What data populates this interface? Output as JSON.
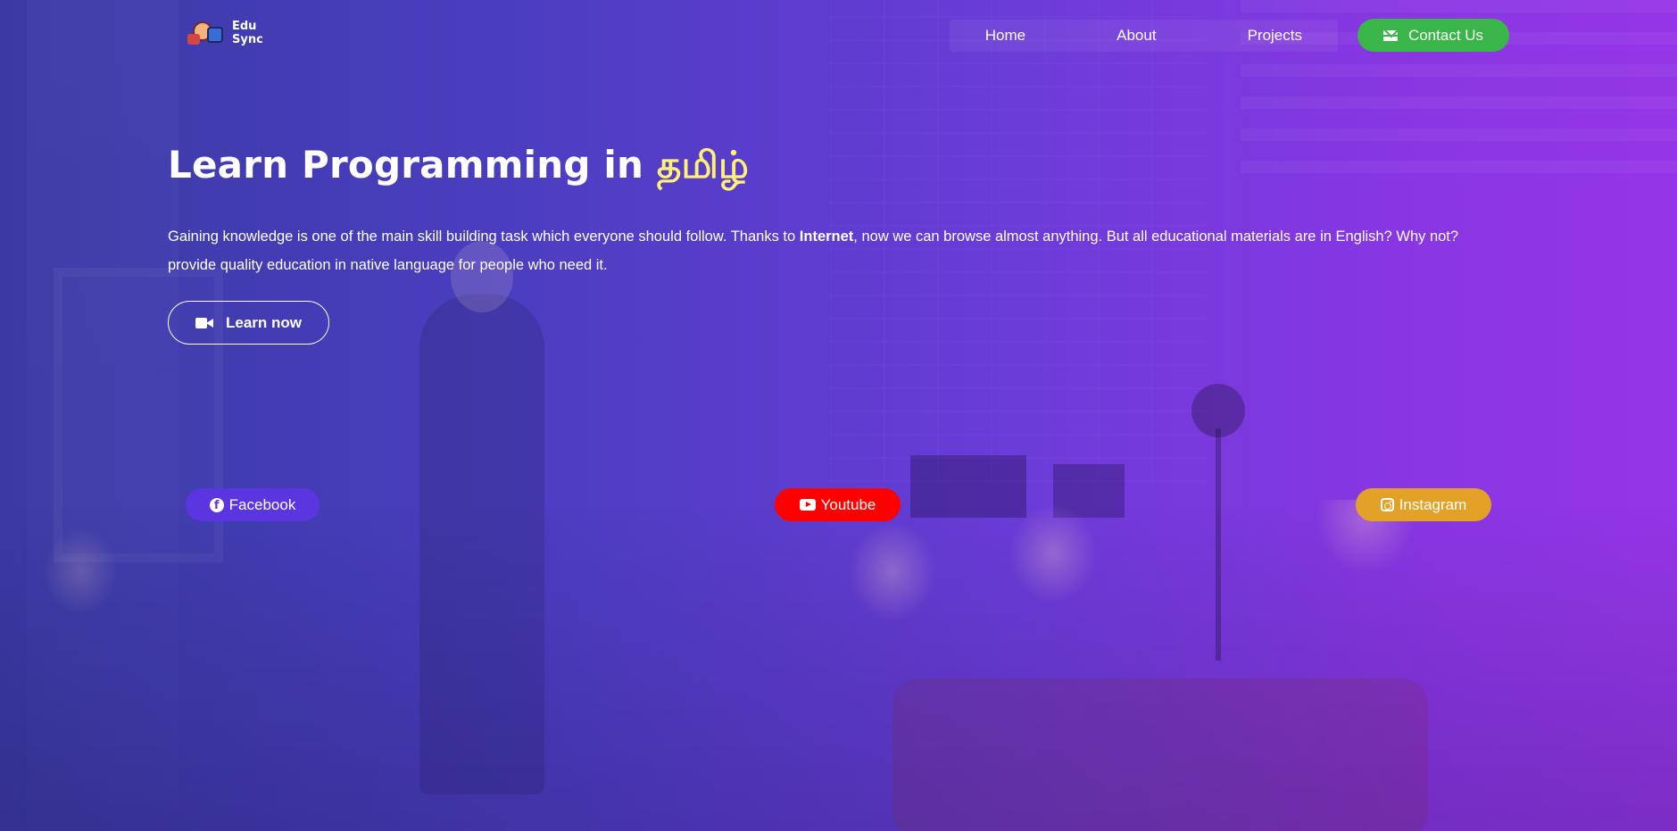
{
  "brand": {
    "name_line1": "Edu",
    "name_line2": "Sync"
  },
  "nav": {
    "items": [
      {
        "label": "Home"
      },
      {
        "label": "About"
      },
      {
        "label": "Projects"
      }
    ],
    "contact": {
      "label": "Contact Us",
      "icon": "envelope-icon",
      "color": "#3ab54a"
    }
  },
  "hero": {
    "title_prefix": "Learn Programming in ",
    "title_accent": "தமிழ்",
    "accent_color": "#fff176",
    "desc_part1": "Gaining knowledge is one of the main skill building task which everyone should follow. Thanks to ",
    "desc_bold": "Internet",
    "desc_part2": ", now we can browse almost anything. But all educational materials are in English? Why not? provide quality education in native language for people who need it.",
    "cta": {
      "label": "Learn now",
      "icon": "video-camera-icon"
    }
  },
  "social": [
    {
      "label": "Facebook",
      "icon": "facebook-icon",
      "color": "#5b35e0"
    },
    {
      "label": "Youtube",
      "icon": "youtube-icon",
      "color": "#ff0000"
    },
    {
      "label": "Instagram",
      "icon": "instagram-icon",
      "color": "#e3a127"
    }
  ]
}
